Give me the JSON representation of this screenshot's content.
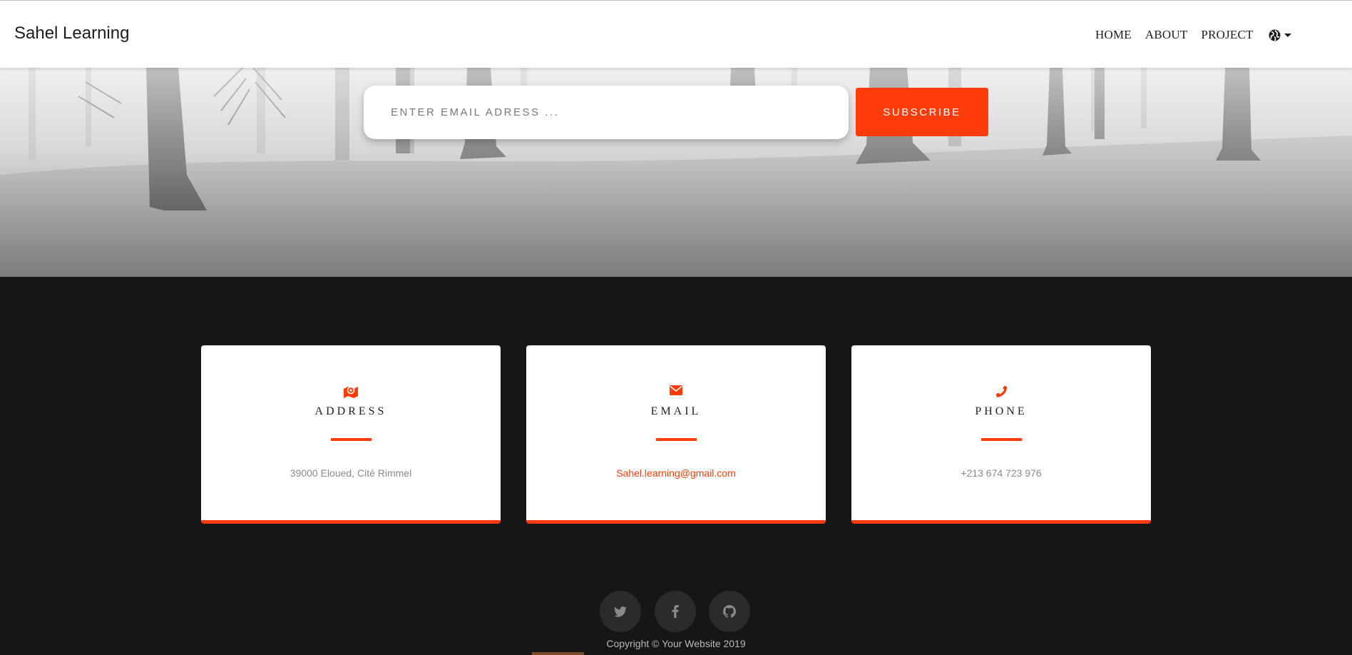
{
  "header": {
    "brand": "Sahel Learning",
    "nav": [
      "HOME",
      "ABOUT",
      "PROJECT"
    ],
    "language_icon": "globe-icon"
  },
  "hero": {
    "email_placeholder": "ENTER EMAIL ADRESS ...",
    "subscribe_label": "SUBSCRIBE"
  },
  "contact": {
    "address": {
      "icon": "map-marker-icon",
      "title": "ADDRESS",
      "text": "39000 Eloued, Cité Rimmel"
    },
    "email": {
      "icon": "envelope-icon",
      "title": "EMAIL",
      "text": "Sahel.learning@gmail.com"
    },
    "phone": {
      "icon": "phone-icon",
      "title": "PHONE",
      "text": "+213 674 723 976"
    }
  },
  "footer": {
    "social": [
      "twitter-icon",
      "facebook-icon",
      "github-icon"
    ],
    "copyright": "Copyright © Your Website 2019"
  },
  "colors": {
    "accent": "#ff3c0a",
    "footer_bg": "#161616",
    "card_bg": "#ffffff"
  }
}
